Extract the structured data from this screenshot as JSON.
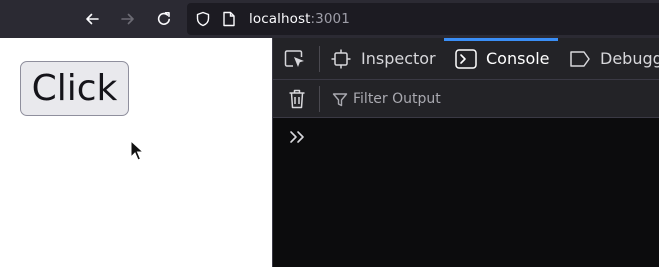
{
  "browser": {
    "url_host": "localhost",
    "url_port": ":3001",
    "icons": [
      "back-arrow-icon",
      "forward-arrow-icon",
      "reload-icon",
      "shield-icon",
      "page-icon"
    ]
  },
  "page": {
    "button_label": "Click"
  },
  "devtools": {
    "tabs": [
      {
        "label": "Inspector",
        "icon": "inspector-icon"
      },
      {
        "label": "Console",
        "icon": "console-icon",
        "active": true
      },
      {
        "label": "Debugg",
        "icon": "debugger-icon"
      }
    ],
    "filter_placeholder": "Filter Output",
    "colors": {
      "active_tab_underline": "#3a8ef6",
      "panel_bg": "#0c0c0d",
      "toolbar_bg": "#2b2a33"
    }
  }
}
